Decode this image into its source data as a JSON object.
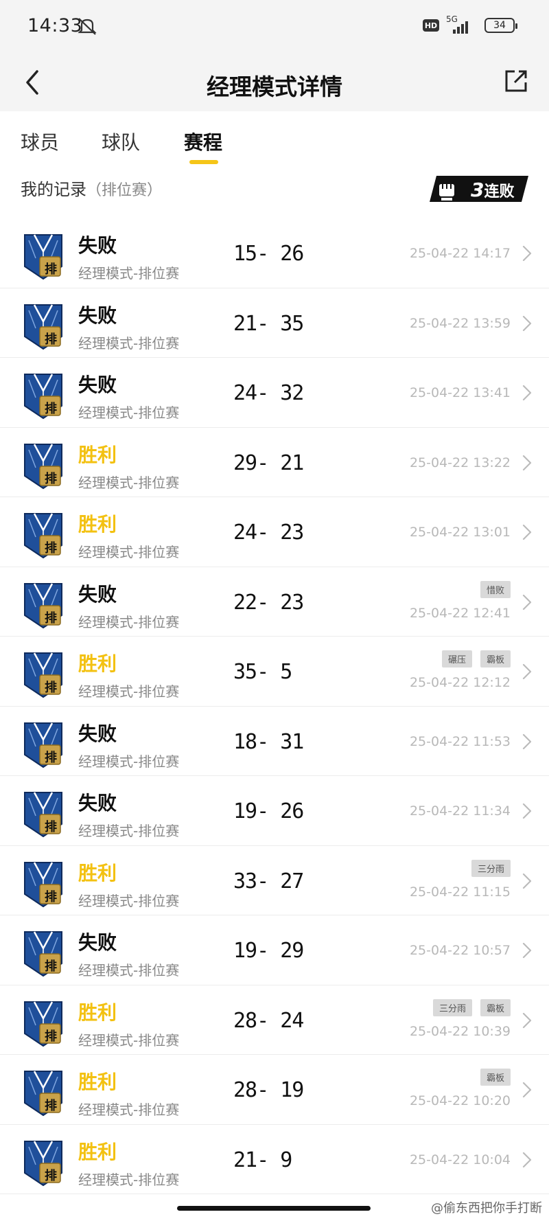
{
  "status_bar": {
    "time": "14:33",
    "network": "5G",
    "battery": "34"
  },
  "header": {
    "title": "经理模式详情"
  },
  "tabs": [
    {
      "label": "球员",
      "active": false
    },
    {
      "label": "球队",
      "active": false
    },
    {
      "label": "赛程",
      "active": true
    }
  ],
  "record": {
    "label": "我的记录",
    "sub": "（排位赛）",
    "streak_count": "3",
    "streak_text": "连败"
  },
  "badge_char": "排",
  "matches": [
    {
      "result": "失败",
      "win": false,
      "mode": "经理模式-排位赛",
      "score": "15- 26",
      "date": "25-04-22 14:17",
      "tags": []
    },
    {
      "result": "失败",
      "win": false,
      "mode": "经理模式-排位赛",
      "score": "21- 35",
      "date": "25-04-22 13:59",
      "tags": []
    },
    {
      "result": "失败",
      "win": false,
      "mode": "经理模式-排位赛",
      "score": "24- 32",
      "date": "25-04-22 13:41",
      "tags": []
    },
    {
      "result": "胜利",
      "win": true,
      "mode": "经理模式-排位赛",
      "score": "29- 21",
      "date": "25-04-22 13:22",
      "tags": []
    },
    {
      "result": "胜利",
      "win": true,
      "mode": "经理模式-排位赛",
      "score": "24- 23",
      "date": "25-04-22 13:01",
      "tags": []
    },
    {
      "result": "失败",
      "win": false,
      "mode": "经理模式-排位赛",
      "score": "22- 23",
      "date": "25-04-22 12:41",
      "tags": [
        "惜败"
      ]
    },
    {
      "result": "胜利",
      "win": true,
      "mode": "经理模式-排位赛",
      "score": "35- 5",
      "date": "25-04-22 12:12",
      "tags": [
        "碾压",
        "霸板"
      ]
    },
    {
      "result": "失败",
      "win": false,
      "mode": "经理模式-排位赛",
      "score": "18- 31",
      "date": "25-04-22 11:53",
      "tags": []
    },
    {
      "result": "失败",
      "win": false,
      "mode": "经理模式-排位赛",
      "score": "19- 26",
      "date": "25-04-22 11:34",
      "tags": []
    },
    {
      "result": "胜利",
      "win": true,
      "mode": "经理模式-排位赛",
      "score": "33- 27",
      "date": "25-04-22 11:15",
      "tags": [
        "三分雨"
      ]
    },
    {
      "result": "失败",
      "win": false,
      "mode": "经理模式-排位赛",
      "score": "19- 29",
      "date": "25-04-22 10:57",
      "tags": []
    },
    {
      "result": "胜利",
      "win": true,
      "mode": "经理模式-排位赛",
      "score": "28- 24",
      "date": "25-04-22 10:39",
      "tags": [
        "三分雨",
        "霸板"
      ]
    },
    {
      "result": "胜利",
      "win": true,
      "mode": "经理模式-排位赛",
      "score": "28- 19",
      "date": "25-04-22 10:20",
      "tags": [
        "霸板"
      ]
    },
    {
      "result": "胜利",
      "win": true,
      "mode": "经理模式-排位赛",
      "score": "21- 9",
      "date": "25-04-22 10:04",
      "tags": []
    }
  ],
  "watermark": "@偷东西把你手打断",
  "colors": {
    "win": "#f3c111",
    "loss": "#111111",
    "accent": "#f5c518",
    "badge_blue": "#1f4f9a",
    "badge_gold": "#c9a24a"
  }
}
